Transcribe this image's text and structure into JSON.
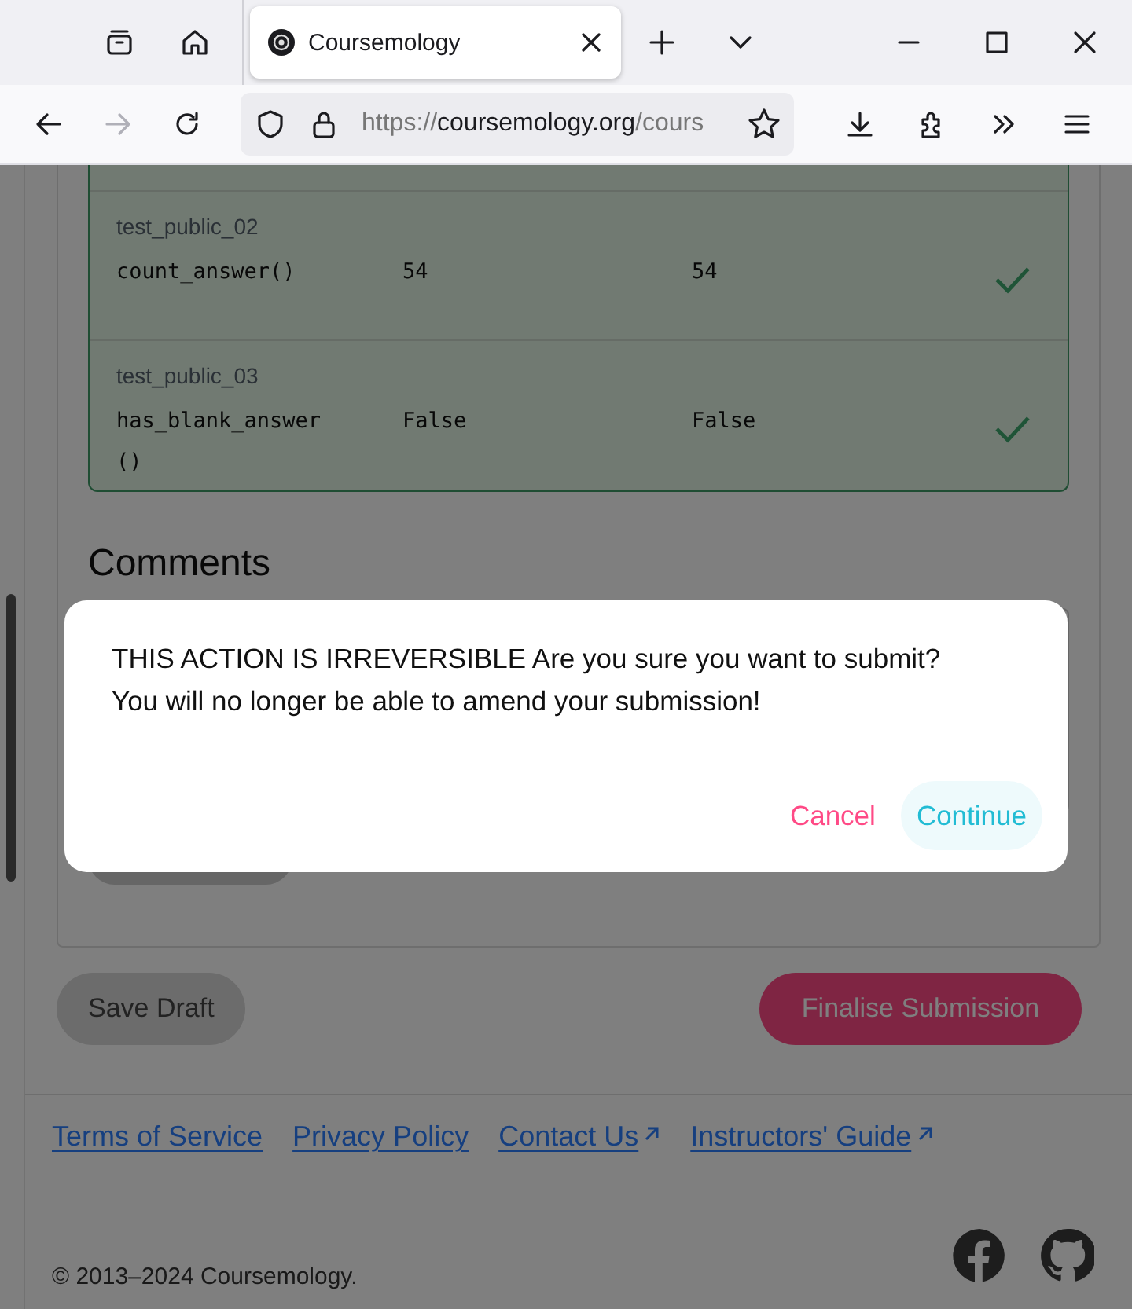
{
  "browser": {
    "tab": {
      "title": "Coursemology",
      "selected": true
    },
    "url": {
      "scheme": "https://",
      "host": "coursemology.org",
      "path": "/cours"
    },
    "forward_disabled": true
  },
  "test_cases": [
    {
      "name": "test_public_02",
      "expression": "count_answer()",
      "expected": "54",
      "output": "54",
      "passed": true
    },
    {
      "name": "test_public_03",
      "expression": "has_blank_answer\n()",
      "expected": "False",
      "output": "False",
      "passed": true
    }
  ],
  "comments_heading": "Comments",
  "dialog": {
    "message": "THIS ACTION IS IRREVERSIBLE Are you sure you want to submit? You will no longer be able to amend your submission!",
    "buttons": [
      {
        "label": "Cancel",
        "kind": "cancel",
        "focused": false
      },
      {
        "label": "Continue",
        "kind": "confirm",
        "focused": true
      }
    ]
  },
  "actions": [
    {
      "label": "Save Draft",
      "kind": "secondary",
      "disabled": true
    },
    {
      "label": "Finalise Submission",
      "kind": "primary",
      "disabled": false
    }
  ],
  "footer": {
    "links": [
      {
        "label": "Terms of Service",
        "external": false
      },
      {
        "label": "Privacy Policy",
        "external": false
      },
      {
        "label": "Contact Us",
        "external": true
      },
      {
        "label": "Instructors' Guide",
        "external": true
      }
    ],
    "copyright": "© 2013–2024 Coursemology."
  }
}
